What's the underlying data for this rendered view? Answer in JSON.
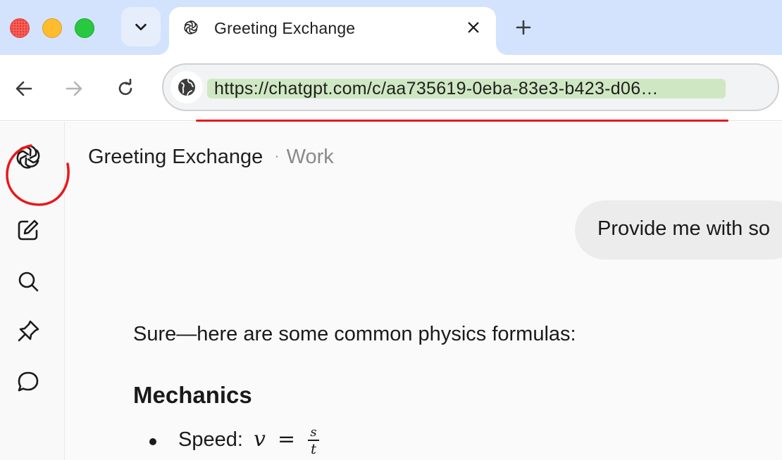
{
  "browser": {
    "tab": {
      "title": "Greeting Exchange",
      "favicon": "openai-logo-icon"
    },
    "address_bar": {
      "url": "https://chatgpt.com/c/aa735619-0eba-83e3-b423-d06…"
    },
    "accent_colors": {
      "tabstrip": "#d3e3fd",
      "url_highlight": "#cfe8c3",
      "annotation_red": "#e8181b"
    }
  },
  "sidebar": {
    "items": [
      {
        "name": "openai-logo",
        "icon": "openai-logo-icon"
      },
      {
        "name": "new-chat",
        "icon": "edit-icon"
      },
      {
        "name": "search",
        "icon": "search-icon"
      },
      {
        "name": "pin",
        "icon": "pin-icon"
      },
      {
        "name": "chats",
        "icon": "chat-bubble-icon"
      }
    ]
  },
  "conversation": {
    "title": "Greeting Exchange",
    "separator": "·",
    "project": "Work",
    "user_message": "Provide me with so",
    "assistant": {
      "intro": "Sure—here are some common physics formulas:",
      "section_heading": "Mechanics",
      "items": [
        {
          "label": "Speed:",
          "formula_lhs": "v",
          "formula_eq": "=",
          "numerator": "s",
          "denominator": "t"
        }
      ]
    }
  }
}
